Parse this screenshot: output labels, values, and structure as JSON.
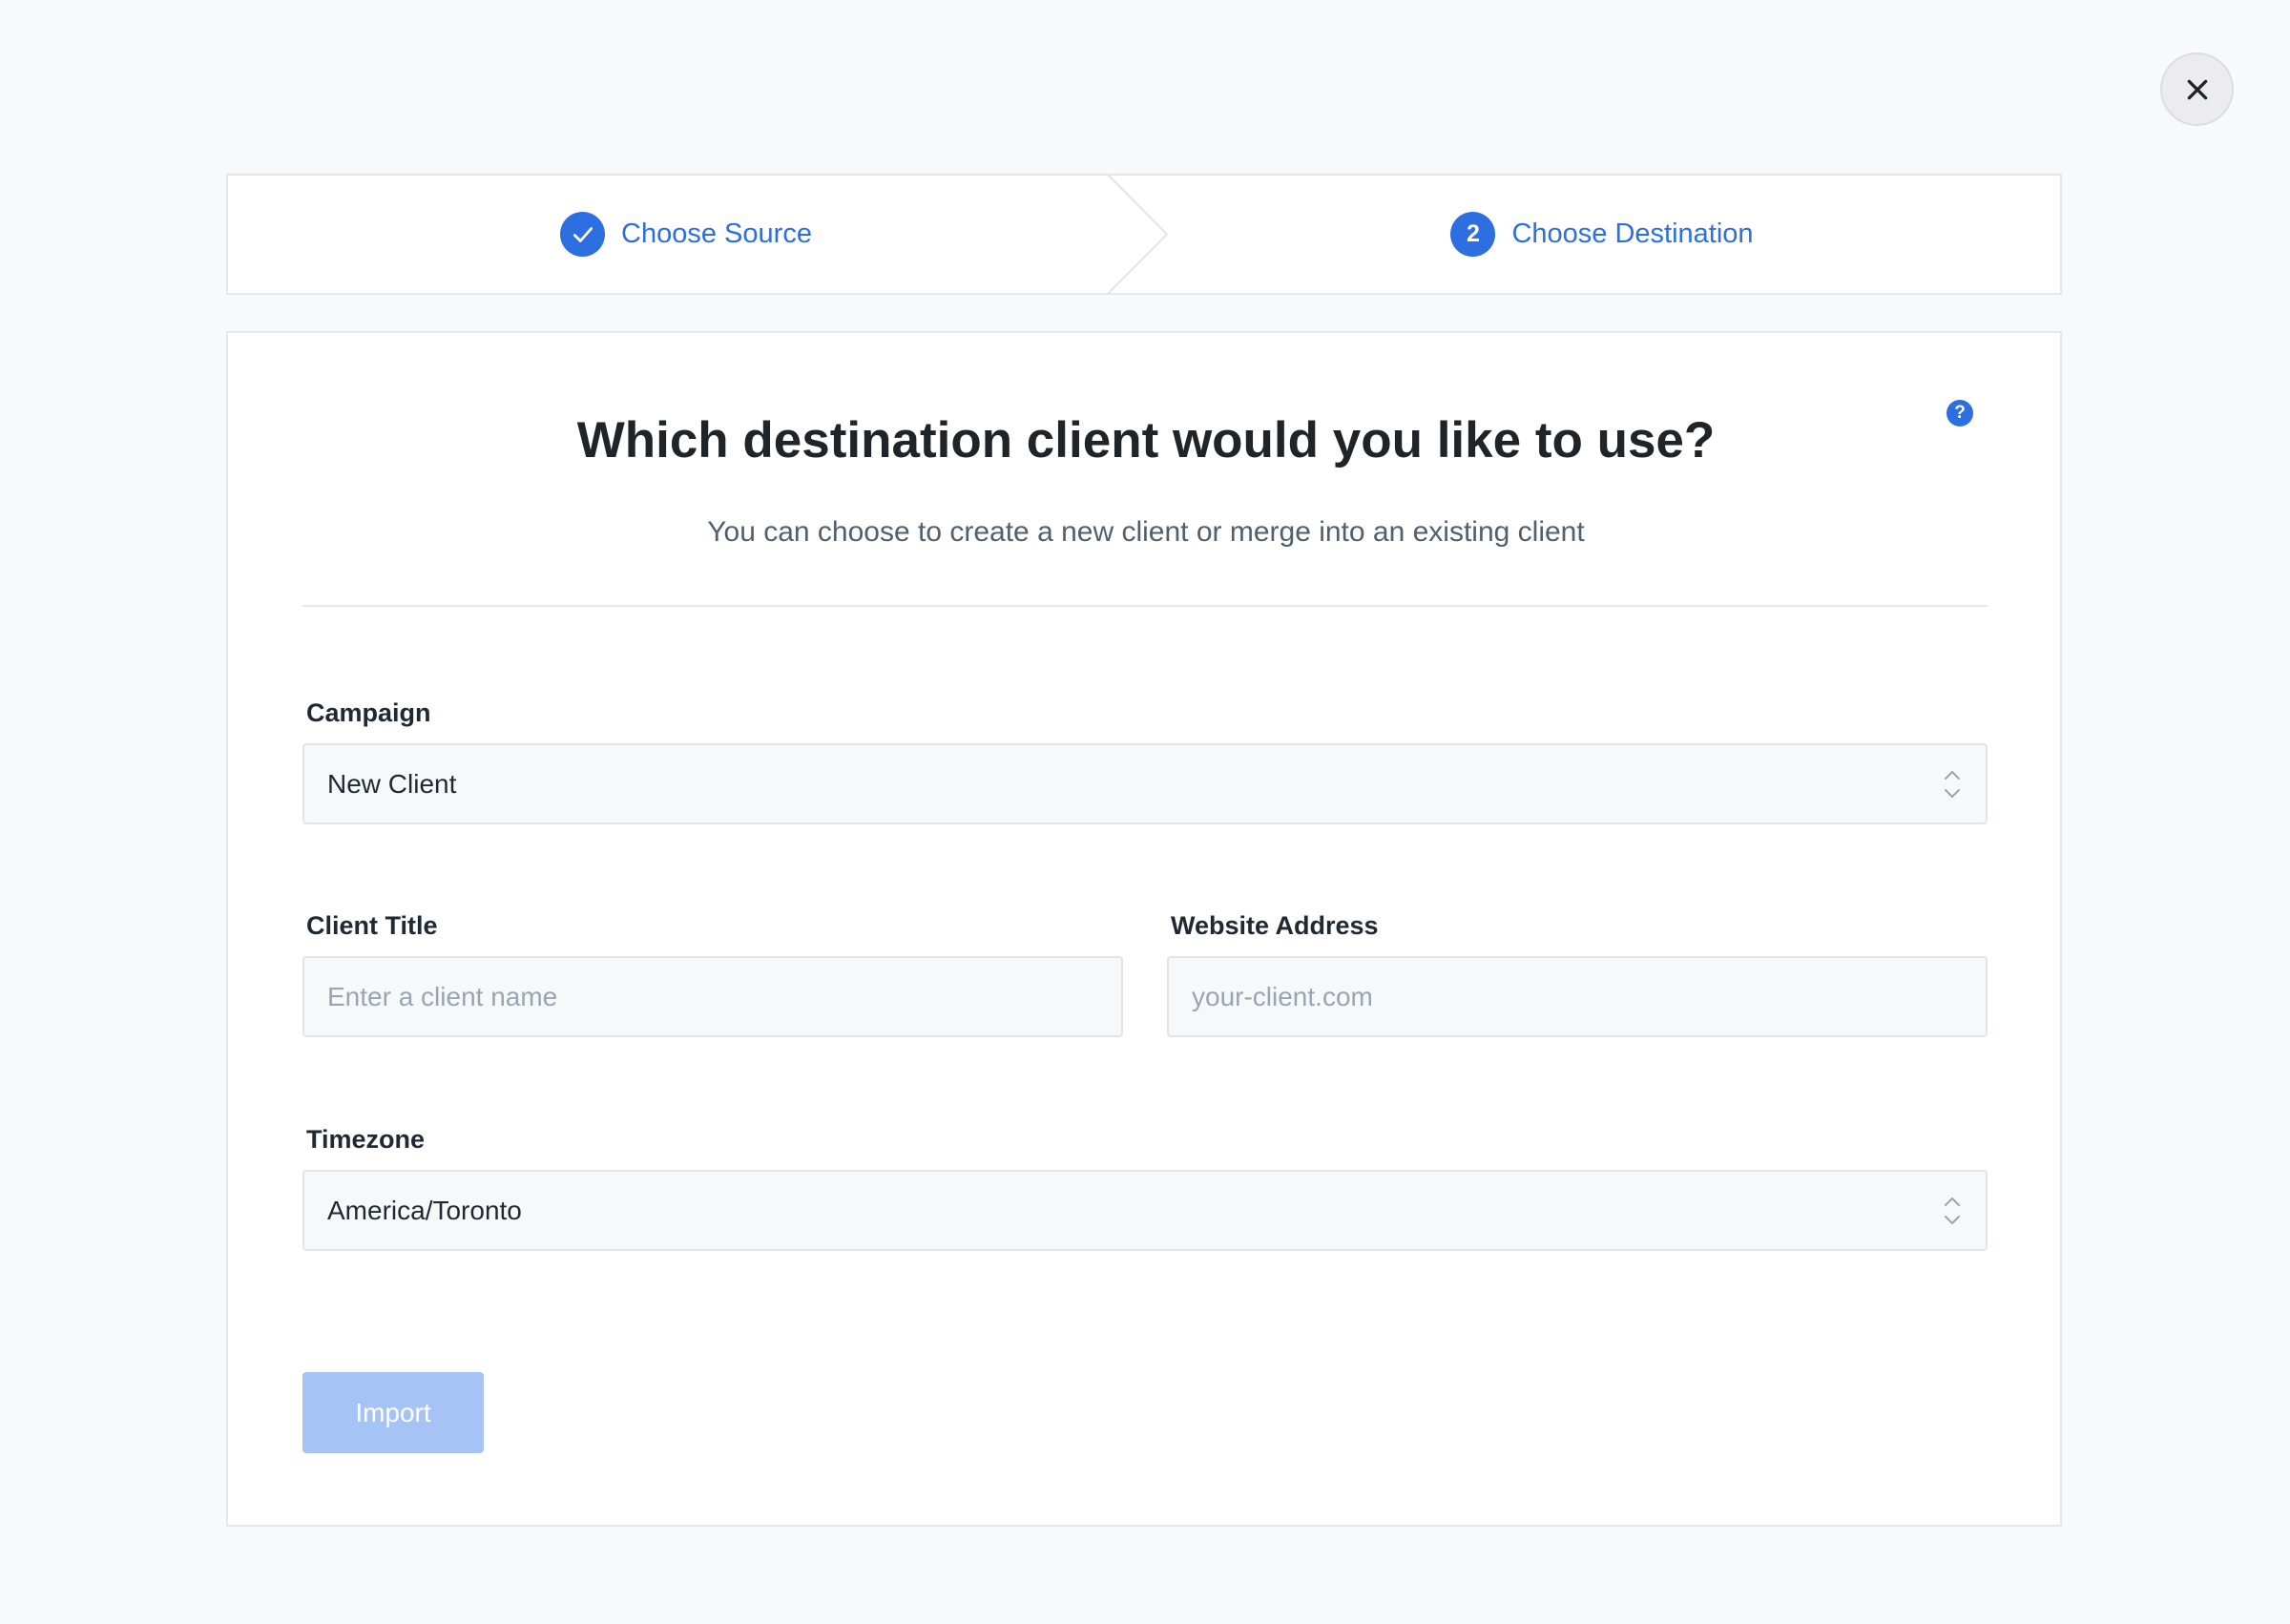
{
  "stepper": {
    "steps": [
      {
        "label": "Choose Source",
        "status": "completed"
      },
      {
        "label": "Choose Destination",
        "number": "2",
        "status": "active"
      }
    ]
  },
  "card": {
    "help_icon": "?",
    "title": "Which destination client would you like to use?",
    "subtitle": "You can choose to create a new client or merge into an existing client"
  },
  "form": {
    "campaign": {
      "label": "Campaign",
      "value": "New Client"
    },
    "client_title": {
      "label": "Client Title",
      "placeholder": "Enter a client name",
      "value": ""
    },
    "website_address": {
      "label": "Website Address",
      "placeholder": "your-client.com",
      "value": ""
    },
    "timezone": {
      "label": "Timezone",
      "value": "America/Toronto"
    },
    "import_label": "Import"
  },
  "colors": {
    "accent": "#2d6ee0",
    "import_disabled": "#a6c3f5",
    "background": "#f8f9fb"
  },
  "icons": {
    "close": "close-icon",
    "completed_step": "checkmark-icon",
    "help": "help-icon",
    "select_arrows": "chevron-up-down-icon"
  }
}
